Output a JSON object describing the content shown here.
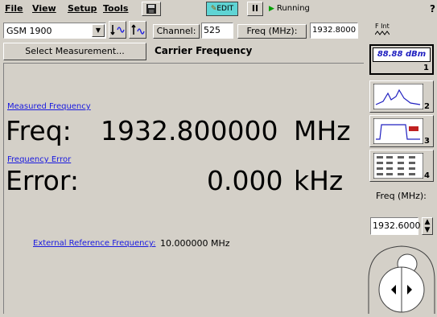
{
  "menu": {
    "file": "File",
    "view": "View",
    "setup": "Setup",
    "tools": "Tools",
    "edit_label": "EDIT",
    "pause_label": "II",
    "run_status": "Running",
    "help_label": "?"
  },
  "toolbar": {
    "standard_value": "GSM 1900",
    "channel_label": "Channel:",
    "channel_value": "525",
    "freq_label": "Freq (MHz):",
    "freq_value": "1932.8000",
    "ref_label_1": "F Int"
  },
  "header": {
    "select_measurement_label": "Select Measurement...",
    "measurement_title": "Carrier Frequency"
  },
  "results": {
    "measured_frequency_link": "Measured Frequency",
    "freq_prefix": "Freq:",
    "freq_value": "1932.800000",
    "freq_unit": "MHz",
    "frequency_error_link": "Frequency Error",
    "error_prefix": "Error:",
    "error_value": "0.000",
    "error_unit": "kHz",
    "ext_ref_link": "External Reference Frequency:",
    "ext_ref_value": "10.000000 MHz"
  },
  "right_panel": {
    "view1_lcd": "88.88 dBm",
    "view1_num": "1",
    "view2_num": "2",
    "view3_num": "3",
    "view4_num": "4",
    "freq_label": "Freq (MHz):",
    "freq_value": "1932.6000"
  }
}
